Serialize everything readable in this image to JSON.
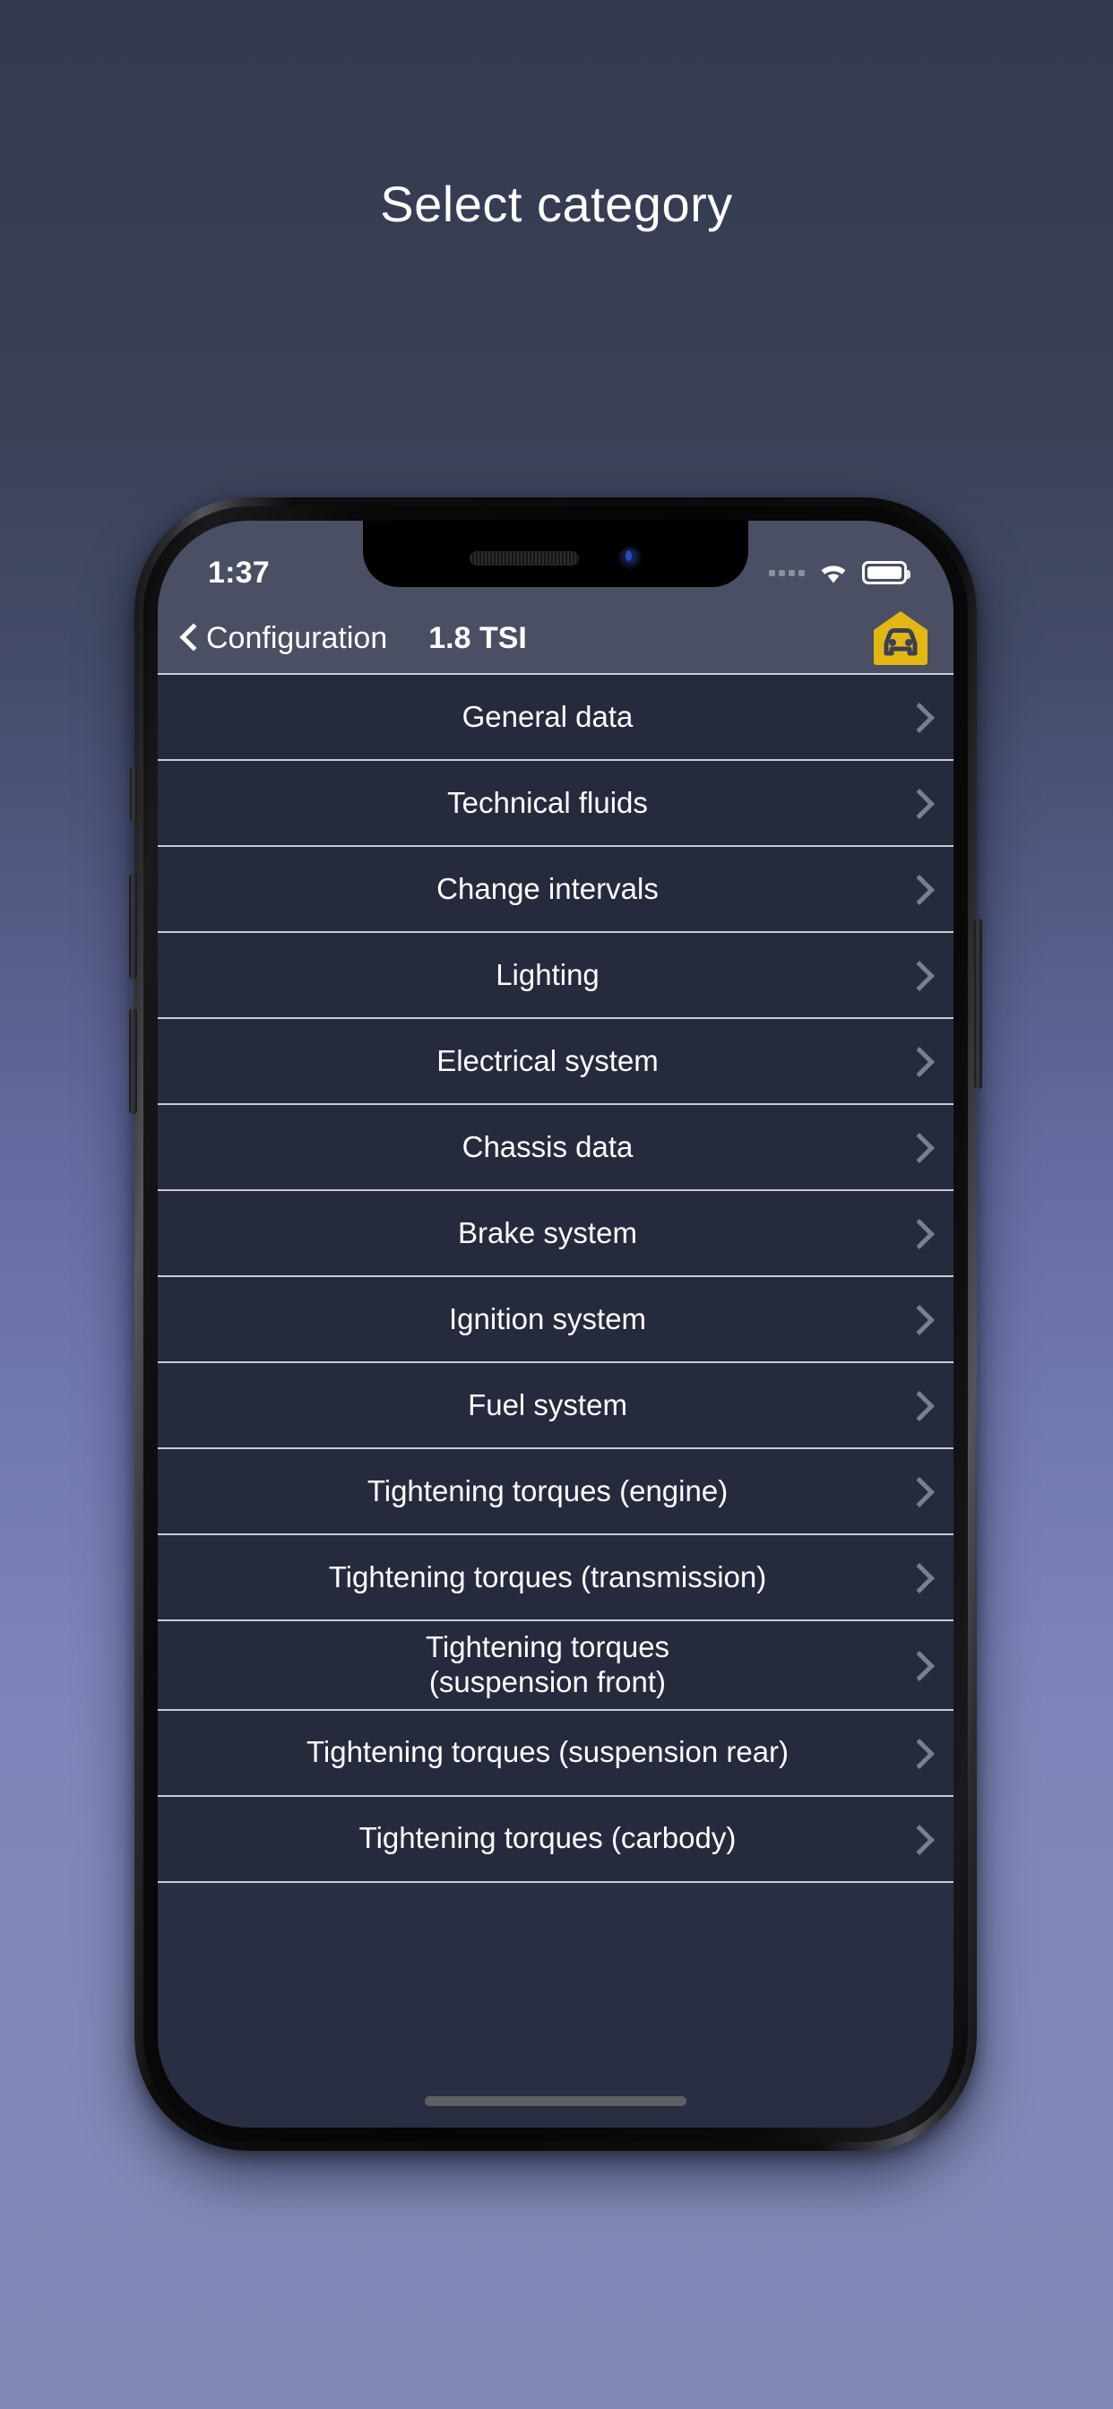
{
  "page": {
    "title": "Select category",
    "background_top_color": "#343a4f",
    "background_bottom_color": "#8088b6"
  },
  "status_bar": {
    "time": "1:37",
    "signal_icon": "signal-dots-icon",
    "wifi_icon": "wifi-icon",
    "battery_icon": "battery-full-icon"
  },
  "nav_bar": {
    "back_icon": "chevron-left-icon",
    "back_label": "Configuration",
    "title": "1.8 TSI",
    "right_icon": "garage-car-icon",
    "right_icon_color": "#E2B714",
    "background_color": "#4a4f63"
  },
  "list": {
    "chevron_icon": "chevron-right-icon",
    "separator_color": "#c9ccd6",
    "row_background": "#262a3d",
    "items": [
      {
        "label": "General data"
      },
      {
        "label": "Technical fluids"
      },
      {
        "label": "Change intervals"
      },
      {
        "label": "Lighting"
      },
      {
        "label": "Electrical system"
      },
      {
        "label": "Chassis data"
      },
      {
        "label": "Brake system"
      },
      {
        "label": "Ignition system"
      },
      {
        "label": "Fuel system"
      },
      {
        "label": "Tightening torques (engine)"
      },
      {
        "label": "Tightening torques (transmission)"
      },
      {
        "label": "Tightening torques\n(suspension front)"
      },
      {
        "label": "Tightening torques (suspension rear)"
      },
      {
        "label": "Tightening torques (carbody)"
      }
    ]
  },
  "home_indicator": {
    "present": true
  }
}
